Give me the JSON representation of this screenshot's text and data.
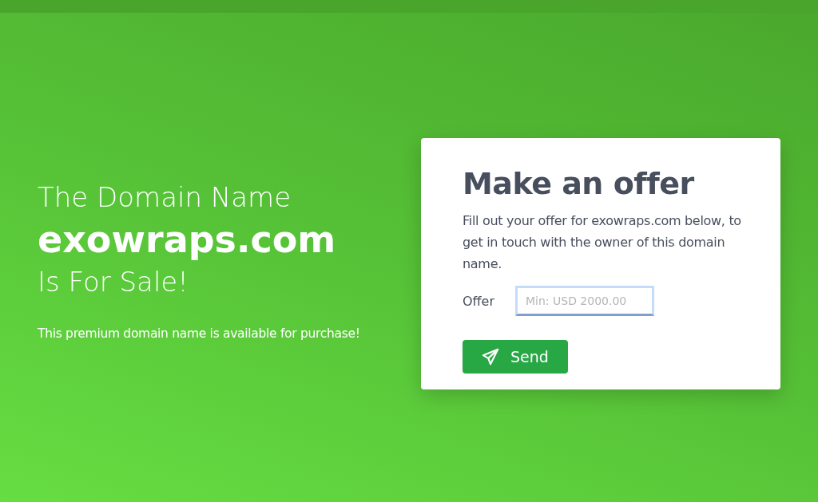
{
  "headline": {
    "line_1": "The Domain Name",
    "domain": "exowraps.com",
    "line_3": "Is For Sale!",
    "tagline": "This premium domain name is available for purchase!"
  },
  "offer_card": {
    "title": "Make an offer",
    "description": "Fill out your offer for exowraps.com below, to get in touch with the owner of this domain name.",
    "field_label": "Offer",
    "placeholder": "Min: USD 2000.00",
    "button": "Send"
  }
}
